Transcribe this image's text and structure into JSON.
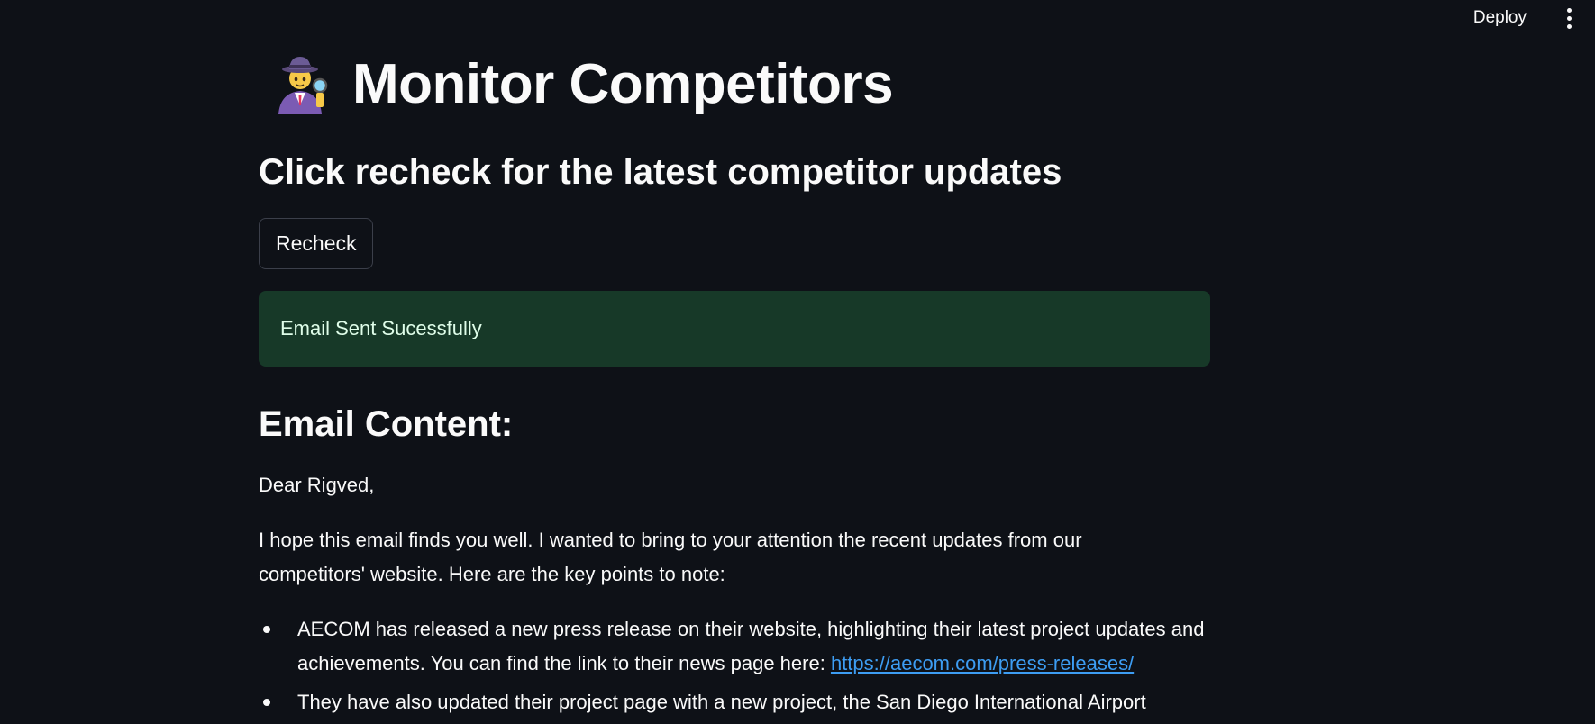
{
  "toolbar": {
    "deploy_label": "Deploy",
    "menu_icon": "vertical-ellipsis-icon"
  },
  "header": {
    "icon": "detective-emoji-icon",
    "title": "Monitor Competitors"
  },
  "subtitle": "Click recheck for the latest competitor updates",
  "recheck_button": {
    "label": "Recheck"
  },
  "alert": {
    "text": "Email Sent Sucessfully",
    "color": "#173928"
  },
  "email": {
    "heading": "Email Content:",
    "greeting": "Dear Rigved,",
    "intro": "I hope this email finds you well. I wanted to bring to your attention the recent updates from our competitors' website. Here are the key points to note:",
    "bullets": [
      {
        "text": "AECOM has released a new press release on their website, highlighting their latest project updates and achievements. You can find the link to their news page here: ",
        "link": "https://aecom.com/press-releases/"
      },
      {
        "text": "They have also updated their project page with a new project, the San Diego International Airport"
      }
    ]
  },
  "colors": {
    "background": "#0e1117",
    "text": "#fafafa",
    "link": "#3d9df3"
  }
}
